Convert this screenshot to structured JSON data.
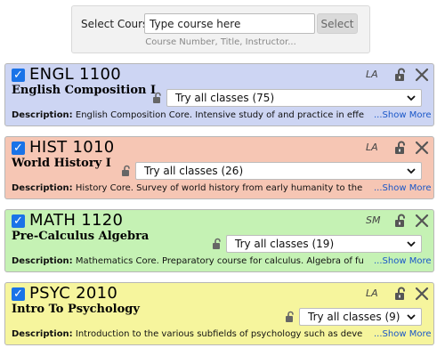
{
  "search": {
    "label": "Select Course",
    "placeholder": "Type course here",
    "button_label": "Select",
    "hint": "Course Number, Title, Instructor..."
  },
  "courses": [
    {
      "code": "ENGL 1100",
      "title": "English Composition I",
      "area": "LA",
      "sections": "Try all classes (75)",
      "description_label": "Description:",
      "description": "English Composition Core. Intensive study of and practice in effe",
      "show_more": "...Show More",
      "color": "#cdd5f3",
      "checked": true
    },
    {
      "code": "HIST 1010",
      "title": "World History I",
      "area": "LA",
      "sections": "Try all classes (26)",
      "description_label": "Description:",
      "description": "History Core. Survey of world history from early humanity to the",
      "show_more": "...Show More",
      "color": "#f6c6b4",
      "checked": true
    },
    {
      "code": "MATH 1120",
      "title": "Pre-Calculus Algebra",
      "area": "SM",
      "sections": "Try all classes (19)",
      "description_label": "Description:",
      "description": "Mathematics Core. Preparatory course for calculus. Algebra of fu",
      "show_more": "...Show More",
      "color": "#c5f2b4",
      "checked": true
    },
    {
      "code": "PSYC 2010",
      "title": "Intro To Psychology",
      "area": "LA",
      "sections": "Try all classes (9)",
      "description_label": "Description:",
      "description": "Introduction to the various subfields of psychology such as deve",
      "show_more": "...Show More",
      "color": "#f6f59d",
      "checked": true
    }
  ],
  "icons": {
    "checkbox": "checkbox-checked-icon",
    "unlock": "unlock-icon",
    "remove": "close-icon",
    "section_lock": "lock-icon",
    "dropdown": "chevron-down-icon"
  },
  "colors": {
    "checkbox": "#1a73e8",
    "show_more_link": "#1a57c8"
  }
}
